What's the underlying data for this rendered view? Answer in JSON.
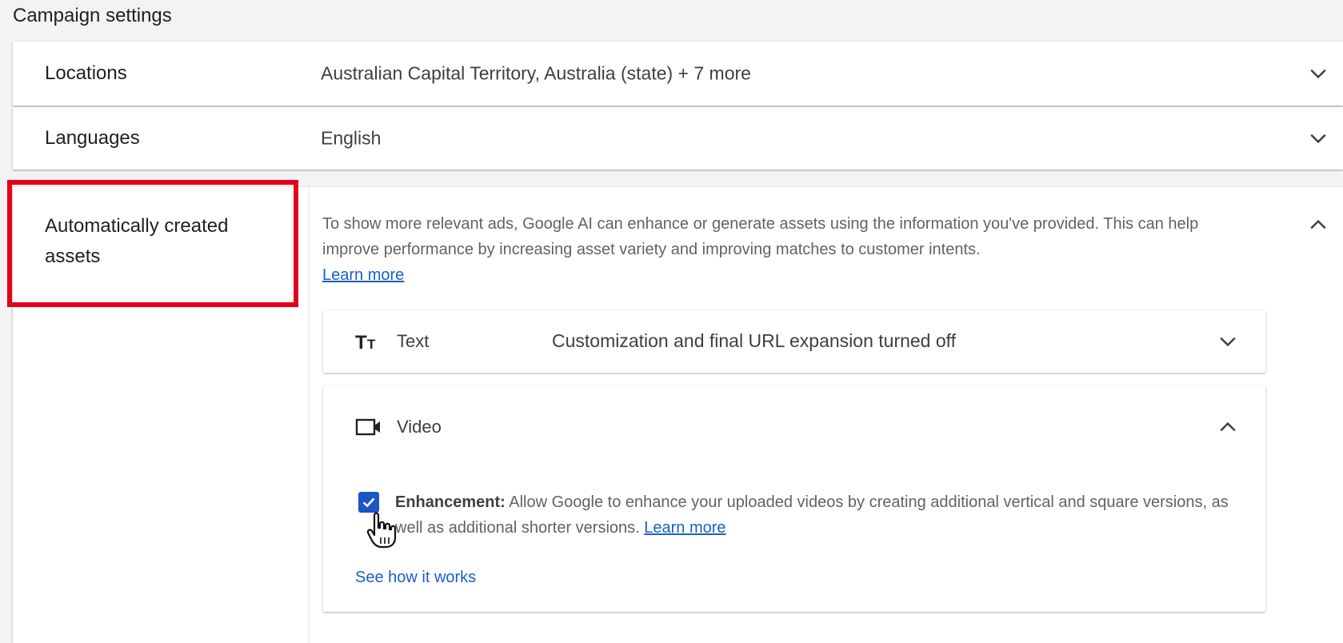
{
  "page": {
    "title": "Campaign settings"
  },
  "rows": {
    "locations": {
      "label": "Locations",
      "value": "Australian Capital Territory, Australia (state) + 7 more"
    },
    "languages": {
      "label": "Languages",
      "value": "English"
    }
  },
  "auto_assets": {
    "label": "Automatically created assets",
    "description": "To show more relevant ads, Google AI can enhance or generate assets using the information you've provided. This can help improve performance by increasing asset variety and improving matches to customer intents.",
    "learn_more": "Learn more",
    "text_card": {
      "icon": "text-format-icon",
      "title": "Text",
      "value": "Customization and final URL expansion turned off"
    },
    "video_card": {
      "icon": "video-camera-icon",
      "title": "Video",
      "enhancement_checked": true,
      "enhancement_label": "Enhancement:",
      "enhancement_text": "Allow Google to enhance your uploaded videos by creating additional vertical and square versions, as well as additional shorter versions.",
      "learn_more": "Learn more",
      "see_how": "See how it works"
    }
  },
  "colors": {
    "accent": "#1a56c4",
    "link": "#1a5fc7",
    "highlight": "#e3001b"
  }
}
